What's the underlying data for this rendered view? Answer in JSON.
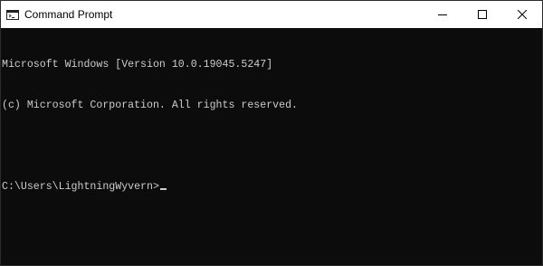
{
  "window": {
    "title": "Command Prompt",
    "app_icon": "cmd-icon"
  },
  "controls": {
    "minimize_icon": "minimize-icon",
    "maximize_icon": "maximize-icon",
    "close_icon": "close-icon"
  },
  "console": {
    "lines": [
      "Microsoft Windows [Version 10.0.19045.5247]",
      "(c) Microsoft Corporation. All rights reserved.",
      ""
    ],
    "prompt": "C:\\Users\\LightningWyvern>"
  },
  "colors": {
    "titlebar": "#ffffff",
    "console_background": "#0c0c0c",
    "console_text": "#cccccc"
  }
}
